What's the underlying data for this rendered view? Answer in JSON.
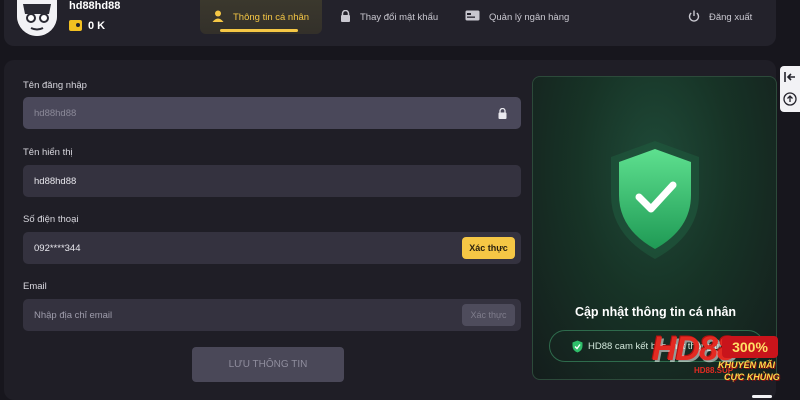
{
  "user": {
    "name": "hd88hd88",
    "balance": "0 K"
  },
  "tabs": {
    "profile": "Thông tin cá nhân",
    "password": "Thay đổi mật khẩu",
    "bank": "Quản lý ngân hàng",
    "logout": "Đăng xuất"
  },
  "form": {
    "username_label": "Tên đăng nhập",
    "username_value": "hd88hd88",
    "display_label": "Tên hiển thị",
    "display_value": "hd88hd88",
    "phone_label": "Số điện thoại",
    "phone_value": "092****344",
    "phone_verify": "Xác thực",
    "email_label": "Email",
    "email_placeholder": "Nhập địa chỉ email",
    "email_verify": "Xác thực",
    "save_label": "LƯU THÔNG TIN"
  },
  "card": {
    "title": "Cập nhật thông tin cá nhân",
    "note": "HD88 cam kết bảo mật thông tin"
  },
  "promo": {
    "brand": "HD88",
    "percent": "300%",
    "line1": "KHUYẾN MÃI",
    "line2": "CỰC KHỦNG",
    "site": "HD88.SUP"
  },
  "colors": {
    "accent": "#f5c745",
    "success": "#2fbf6a",
    "background": "#17161d"
  },
  "icons": [
    "user-icon",
    "lock-icon",
    "bank-card-icon",
    "power-icon",
    "shield-check-icon",
    "collapse-icon",
    "scroll-top-icon",
    "coin-icon"
  ]
}
